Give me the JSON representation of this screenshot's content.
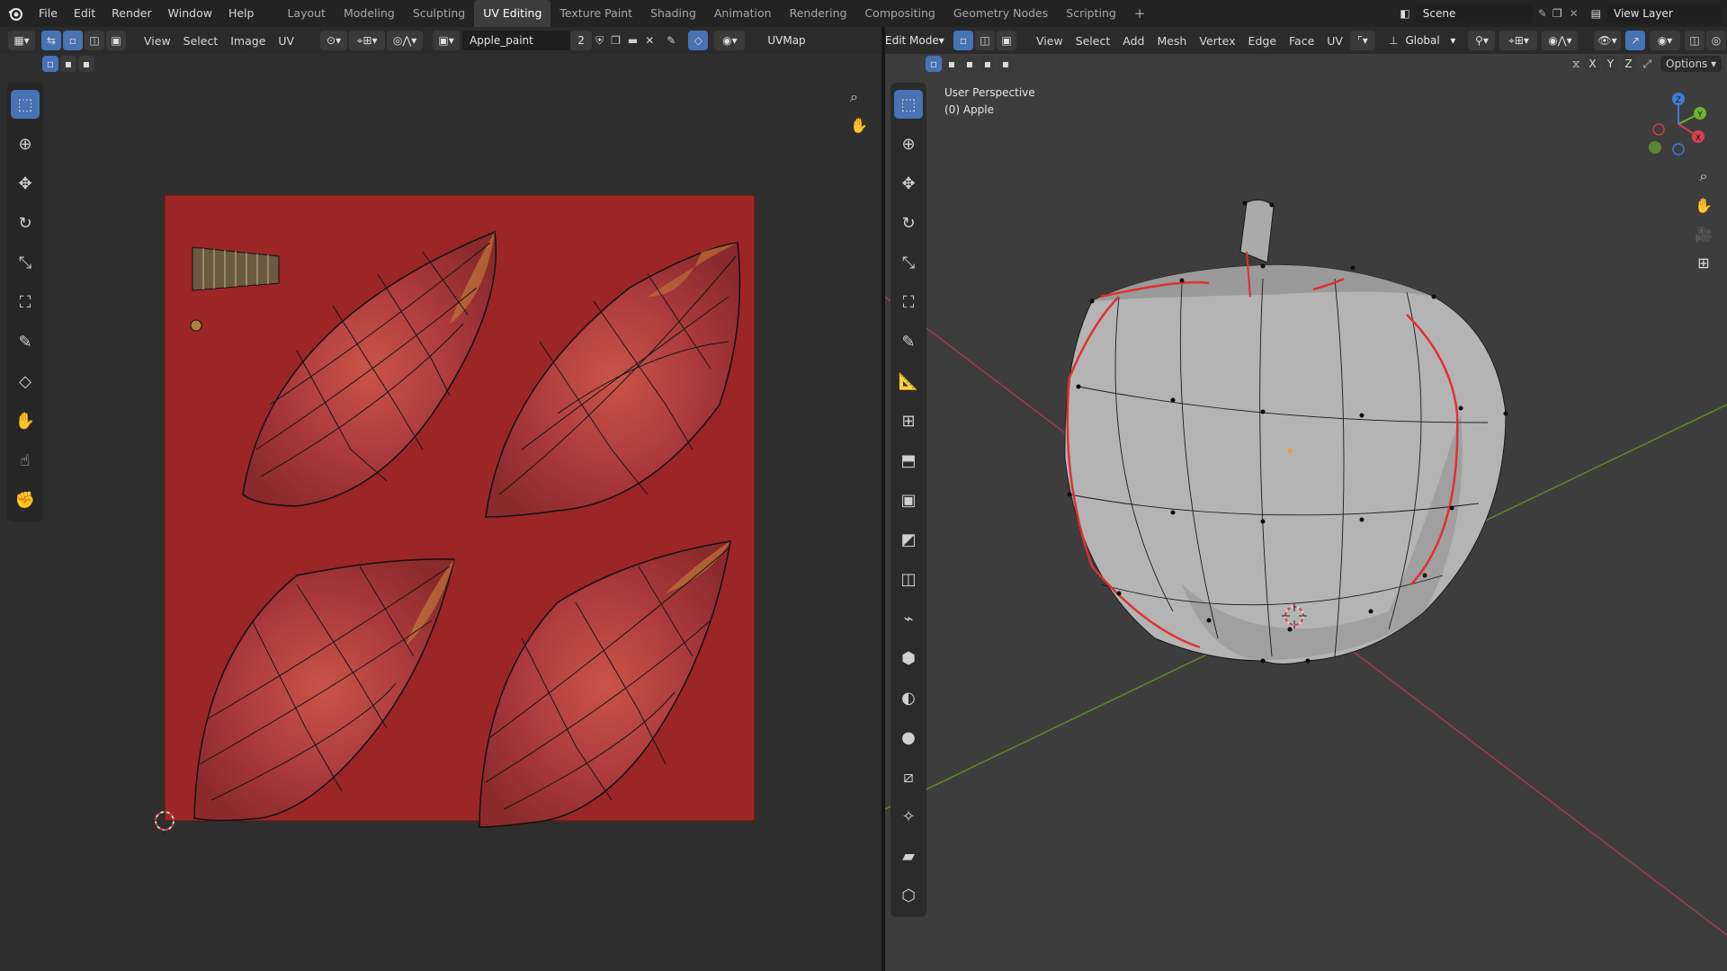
{
  "app": {
    "logo": "blender-logo-icon"
  },
  "top_menu": [
    "File",
    "Edit",
    "Render",
    "Window",
    "Help"
  ],
  "workspaces": [
    "Layout",
    "Modeling",
    "Sculpting",
    "UV Editing",
    "Texture Paint",
    "Shading",
    "Animation",
    "Rendering",
    "Compositing",
    "Geometry Nodes",
    "Scripting"
  ],
  "active_workspace": "UV Editing",
  "scene": {
    "label": "Scene"
  },
  "view_layer": {
    "label": "View Layer"
  },
  "uv_editor": {
    "menus": [
      "View",
      "Select",
      "Image",
      "UV"
    ],
    "image_name": "Apple_paint",
    "user_count": "2",
    "uv_map": "UVMap",
    "tools": [
      "select-box-icon",
      "cursor-icon",
      "move-icon",
      "rotate-icon",
      "scale-icon",
      "transform-icon",
      "annotate-icon",
      "rip-icon",
      "grab-icon",
      "relax-icon",
      "pinch-icon"
    ]
  },
  "viewport": {
    "mode": "Edit Mode",
    "menus": [
      "View",
      "Select",
      "Add",
      "Mesh",
      "Vertex",
      "Edge",
      "Face",
      "UV"
    ],
    "orientation": "Global",
    "options_label": "Options",
    "axes": [
      "X",
      "Y",
      "Z"
    ],
    "overlay_title": "User Perspective",
    "overlay_object": "(0) Apple",
    "tools": [
      "select-box-icon",
      "cursor-icon",
      "move-icon",
      "rotate-icon",
      "scale-icon",
      "transform-icon",
      "annotate-icon",
      "measure-icon",
      "add-cube-icon",
      "extrude-icon",
      "inset-icon",
      "bevel-icon",
      "loop-cut-icon",
      "knife-icon",
      "poly-build-icon",
      "spin-icon",
      "smooth-icon",
      "edge-slide-icon",
      "shrink-fatten-icon",
      "shear-icon",
      "rip-region-icon"
    ]
  },
  "gizmo": {
    "x": "X",
    "y": "Y",
    "z": "Z"
  },
  "colors": {
    "uv_background": "#9c2525",
    "seam": "#e03030",
    "accent": "#4772b3",
    "axis_x": "#c8404e",
    "axis_y": "#6e9b2a"
  }
}
